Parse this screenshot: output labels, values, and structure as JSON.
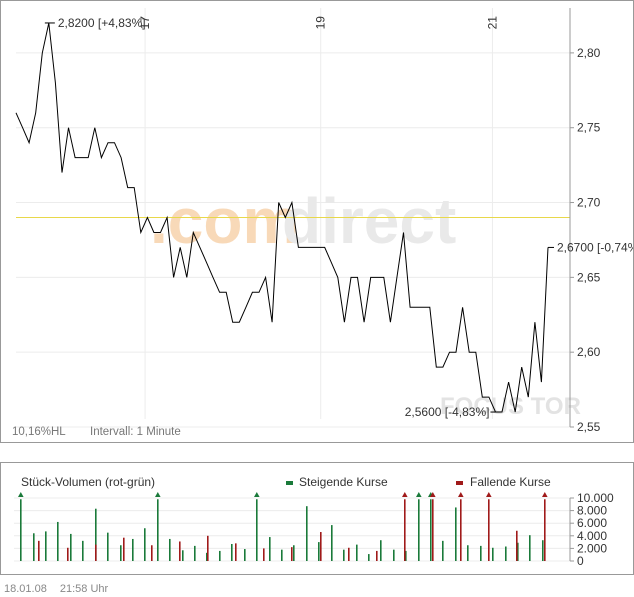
{
  "footer": {
    "date": "18.01.08",
    "time": "21:58 Uhr"
  },
  "price_chart": {
    "watermark_primary": ".com",
    "watermark_secondary": "direct",
    "watermark_bottom": "FOCUS TOR",
    "range_note": "10,16%HL",
    "interval_label": "Intervall: 1 Minute",
    "high_label": "2,8200 [+4,83%]",
    "low_label": "2,5600 [-4,83%]",
    "last_label": "2,6700 [-0,74%]"
  },
  "volume_chart": {
    "title": "Stück-Volumen (rot-grün)",
    "legend_rising": "Steigende Kurse",
    "legend_falling": "Fallende Kurse"
  },
  "colors": {
    "rising": "#1a7a3a",
    "falling": "#a01a1a",
    "reference_line": "#e8d84a",
    "price_line": "#000000"
  },
  "chart_data": [
    {
      "type": "line",
      "x_ticks": [
        "17",
        "19",
        "21"
      ],
      "y_ticks": [
        "2,55",
        "2,60",
        "2,65",
        "2,70",
        "2,75",
        "2,80"
      ],
      "ylim": [
        2.55,
        2.83
      ],
      "reference_value": 2.69,
      "values": [
        2.76,
        2.75,
        2.74,
        2.76,
        2.8,
        2.82,
        2.78,
        2.72,
        2.75,
        2.73,
        2.73,
        2.73,
        2.75,
        2.73,
        2.74,
        2.74,
        2.73,
        2.71,
        2.71,
        2.68,
        2.69,
        2.68,
        2.68,
        2.69,
        2.65,
        2.67,
        2.65,
        2.68,
        2.67,
        2.66,
        2.65,
        2.64,
        2.64,
        2.62,
        2.62,
        2.63,
        2.64,
        2.64,
        2.65,
        2.62,
        2.7,
        2.69,
        2.7,
        2.67,
        2.67,
        2.67,
        2.67,
        2.67,
        2.66,
        2.65,
        2.62,
        2.65,
        2.65,
        2.62,
        2.65,
        2.65,
        2.65,
        2.62,
        2.65,
        2.68,
        2.63,
        2.63,
        2.63,
        2.63,
        2.59,
        2.59,
        2.6,
        2.6,
        2.63,
        2.6,
        2.6,
        2.57,
        2.57,
        2.56,
        2.56,
        2.58,
        2.56,
        2.59,
        2.57,
        2.62,
        2.58,
        2.67
      ],
      "high": 2.82,
      "low": 2.56,
      "last": 2.67
    },
    {
      "type": "bar",
      "y_ticks": [
        "0",
        "2.000",
        "4.000",
        "6.000",
        "8.000",
        "10.000"
      ],
      "ylim": [
        0,
        10000
      ],
      "series": [
        {
          "name": "Steigende Kurse",
          "values": [
            9800,
            4400,
            4700,
            6200,
            4300,
            3200,
            8300,
            4500,
            2500,
            3500,
            5200,
            9800,
            3500,
            1700,
            2400,
            1300,
            1600,
            2700,
            1900,
            9800,
            3800,
            1800,
            2500,
            8700,
            3000,
            5700,
            1800,
            2600,
            1100,
            3300,
            1800,
            1600,
            9800,
            9800,
            3200,
            8500,
            2500,
            2400,
            2100,
            2300,
            2900,
            4100,
            3300
          ]
        },
        {
          "name": "Fallende Kurse",
          "values": [
            3200,
            2100,
            2600,
            3700,
            2500,
            3100,
            4000,
            2800,
            2000,
            2200,
            4600,
            2100,
            1600,
            9800,
            9800,
            9800,
            9800,
            4800,
            9800
          ]
        }
      ]
    }
  ]
}
